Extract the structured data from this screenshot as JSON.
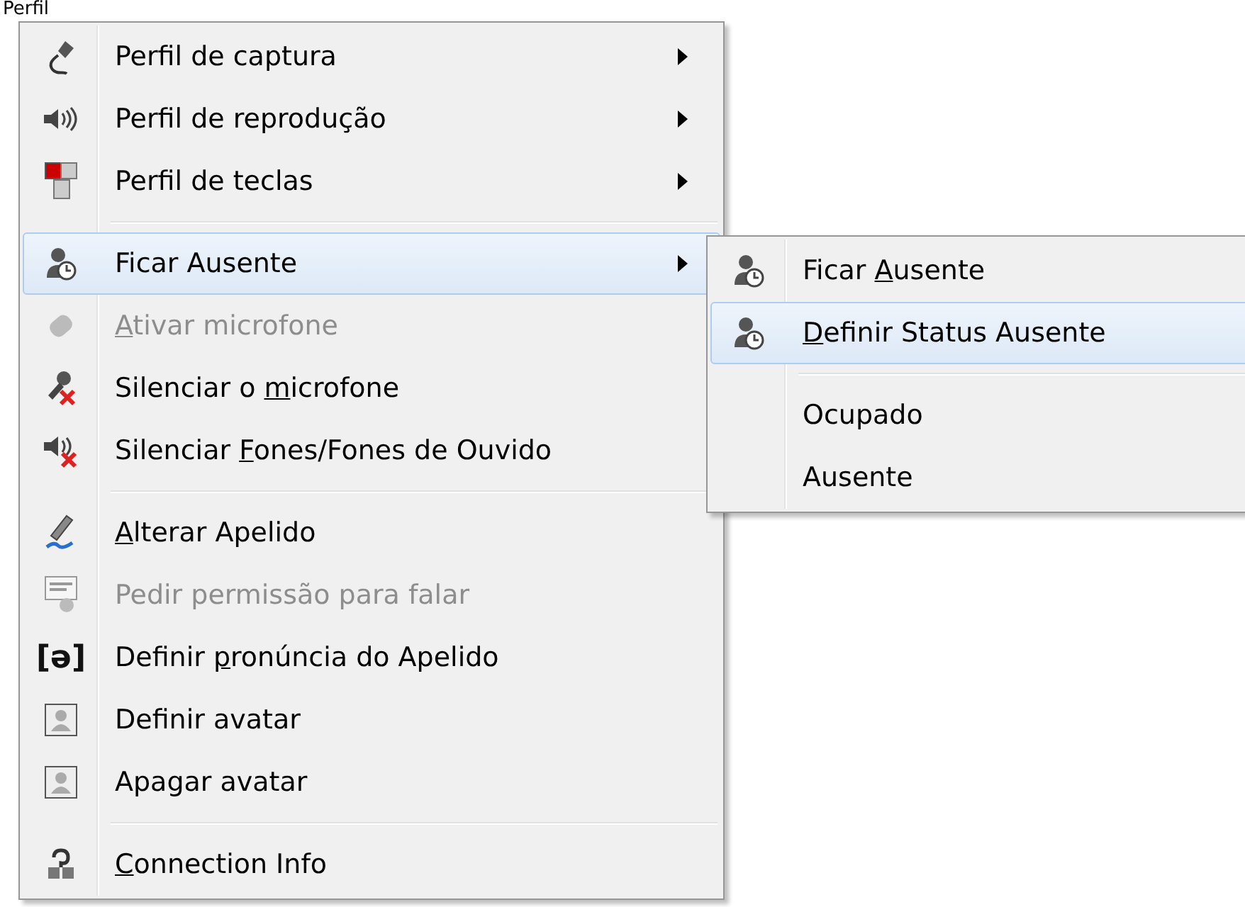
{
  "heading": "Perfil",
  "menu": {
    "groups": [
      {
        "items": [
          {
            "label": [
              {
                "text": "Perfil de captura",
                "underlined": false
              }
            ],
            "disabled": false,
            "selected": false,
            "has_submenu": true
          },
          {
            "label": [
              {
                "text": "Perfil de reprodução",
                "underlined": false
              }
            ],
            "disabled": false,
            "selected": false,
            "has_submenu": true
          },
          {
            "label": [
              {
                "text": "Perfil de teclas",
                "underlined": false
              }
            ],
            "disabled": false,
            "selected": false,
            "has_submenu": true
          }
        ]
      },
      {
        "items": [
          {
            "label": [
              {
                "text": "Ficar Ausente",
                "underlined": false
              }
            ],
            "disabled": false,
            "selected": true,
            "has_submenu": true
          },
          {
            "label": [
              {
                "text": "A",
                "underlined": true
              },
              {
                "text": "tivar microfone",
                "underlined": false
              }
            ],
            "disabled": true,
            "selected": false,
            "has_submenu": false
          },
          {
            "label": [
              {
                "text": "Silenciar o ",
                "underlined": false
              },
              {
                "text": "m",
                "underlined": true
              },
              {
                "text": "icrofone",
                "underlined": false
              }
            ],
            "disabled": false,
            "selected": false,
            "has_submenu": false
          },
          {
            "label": [
              {
                "text": "Silenciar ",
                "underlined": false
              },
              {
                "text": "F",
                "underlined": true
              },
              {
                "text": "ones/Fones de Ouvido",
                "underlined": false
              }
            ],
            "disabled": false,
            "selected": false,
            "has_submenu": false
          }
        ]
      },
      {
        "items": [
          {
            "label": [
              {
                "text": "A",
                "underlined": true
              },
              {
                "text": "lterar Apelido",
                "underlined": false
              }
            ],
            "disabled": false,
            "selected": false,
            "has_submenu": false
          },
          {
            "label": [
              {
                "text": "Pedir permissão para falar",
                "underlined": false
              }
            ],
            "disabled": true,
            "selected": false,
            "has_submenu": false
          },
          {
            "label": [
              {
                "text": "Definir ",
                "underlined": false
              },
              {
                "text": "p",
                "underlined": true
              },
              {
                "text": "ronúncia do Apelido",
                "underlined": false
              }
            ],
            "glyph": "[ə]",
            "disabled": false,
            "selected": false,
            "has_submenu": false
          },
          {
            "label": [
              {
                "text": "Definir avatar",
                "underlined": false
              }
            ],
            "disabled": false,
            "selected": false,
            "has_submenu": false
          },
          {
            "label": [
              {
                "text": "Apagar avatar",
                "underlined": false
              }
            ],
            "disabled": false,
            "selected": false,
            "has_submenu": false
          }
        ]
      },
      {
        "items": [
          {
            "label": [
              {
                "text": "C",
                "underlined": true
              },
              {
                "text": "onnection Info",
                "underlined": false
              }
            ],
            "disabled": false,
            "selected": false,
            "has_submenu": false
          }
        ]
      }
    ]
  },
  "submenu": {
    "groups": [
      {
        "items": [
          {
            "label": [
              {
                "text": "Ficar ",
                "underlined": false
              },
              {
                "text": "A",
                "underlined": true
              },
              {
                "text": "usente",
                "underlined": false
              }
            ],
            "selected": false
          },
          {
            "label": [
              {
                "text": "D",
                "underlined": true
              },
              {
                "text": "efinir Status Ausente",
                "underlined": false
              }
            ],
            "selected": true
          }
        ]
      },
      {
        "items": [
          {
            "label": [
              {
                "text": "Ocupado",
                "underlined": false
              }
            ],
            "selected": false
          },
          {
            "label": [
              {
                "text": "Ausente",
                "underlined": false
              }
            ],
            "selected": false
          }
        ]
      }
    ]
  }
}
